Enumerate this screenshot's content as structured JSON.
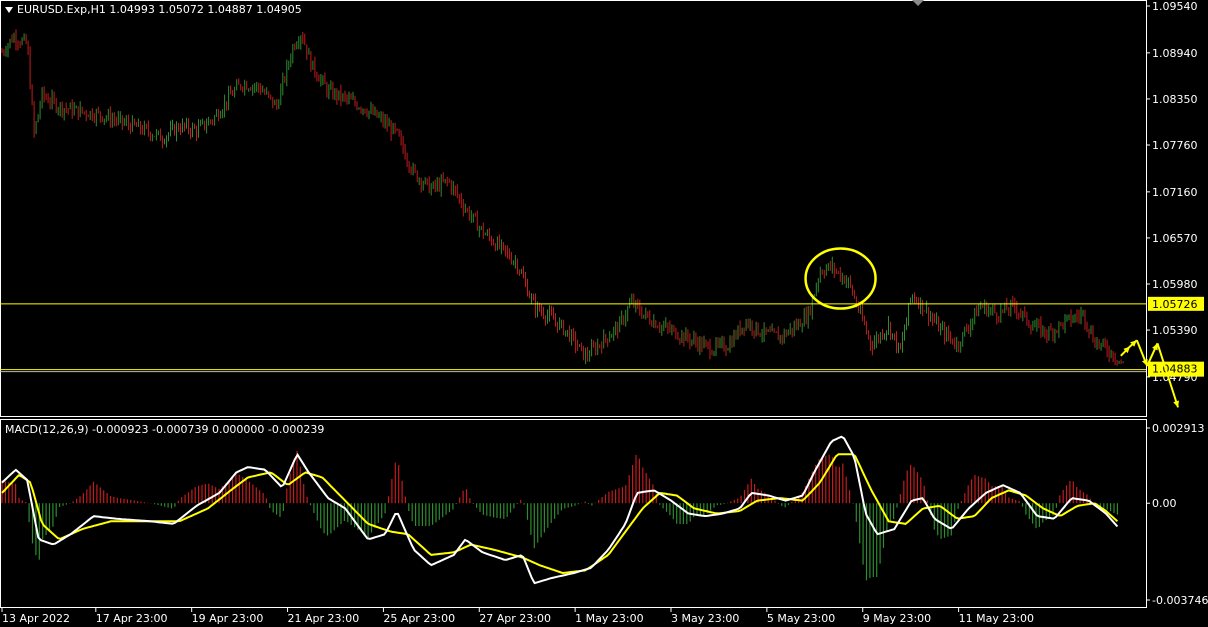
{
  "header": {
    "symbol_info": "EURUSD.Exp,H1  1.04993 1.05072 1.04887 1.04905"
  },
  "macd_header": "MACD(12,26,9) -0.000923 -0.000739 0.000000 -0.000239",
  "colors": {
    "background": "#000000",
    "bull": "#2e8b2e",
    "bear": "#c21c1c",
    "support_resistance": "#ffff00",
    "macd_line": "#ffffff",
    "signal_line": "#ffff00",
    "grid_text": "#ffffff"
  },
  "chart_data": [
    {
      "type": "candlestick",
      "title": "EURUSD.Exp,H1",
      "y_ticks": [
        "1.09540",
        "1.08940",
        "1.08350",
        "1.07760",
        "1.07160",
        "1.06570",
        "1.05980",
        "1.05390",
        "1.04790"
      ],
      "ylim": [
        1.0452,
        1.0954
      ],
      "x_ticks": [
        "13 Apr 2022",
        "17 Apr 23:00",
        "19 Apr 23:00",
        "21 Apr 23:00",
        "25 Apr 23:00",
        "27 Apr 23:00",
        "1 May 23:00",
        "3 May 23:00",
        "5 May 23:00",
        "9 May 23:00",
        "11 May 23:00"
      ],
      "price_path": [
        [
          0,
          1.0895
        ],
        [
          0.01,
          1.0915
        ],
        [
          0.022,
          1.0905
        ],
        [
          0.028,
          1.079
        ],
        [
          0.035,
          1.084
        ],
        [
          0.05,
          1.0825
        ],
        [
          0.065,
          1.082
        ],
        [
          0.085,
          1.0815
        ],
        [
          0.105,
          1.0805
        ],
        [
          0.125,
          1.0795
        ],
        [
          0.14,
          1.0785
        ],
        [
          0.155,
          1.08
        ],
        [
          0.17,
          1.0795
        ],
        [
          0.185,
          1.081
        ],
        [
          0.2,
          1.084
        ],
        [
          0.21,
          1.0855
        ],
        [
          0.225,
          1.085
        ],
        [
          0.24,
          1.0825
        ],
        [
          0.255,
          1.0905
        ],
        [
          0.262,
          1.092
        ],
        [
          0.27,
          1.088
        ],
        [
          0.285,
          1.0845
        ],
        [
          0.3,
          1.0835
        ],
        [
          0.315,
          1.0825
        ],
        [
          0.33,
          1.081
        ],
        [
          0.345,
          1.079
        ],
        [
          0.36,
          1.074
        ],
        [
          0.375,
          1.072
        ],
        [
          0.39,
          1.073
        ],
        [
          0.405,
          1.0695
        ],
        [
          0.42,
          1.0665
        ],
        [
          0.435,
          1.0645
        ],
        [
          0.45,
          1.0625
        ],
        [
          0.465,
          1.057
        ],
        [
          0.48,
          1.0555
        ],
        [
          0.495,
          1.0535
        ],
        [
          0.51,
          1.0505
        ],
        [
          0.525,
          1.0525
        ],
        [
          0.54,
          1.0545
        ],
        [
          0.55,
          1.0575
        ],
        [
          0.56,
          1.056
        ],
        [
          0.575,
          1.0545
        ],
        [
          0.59,
          1.0535
        ],
        [
          0.605,
          1.0525
        ],
        [
          0.62,
          1.0515
        ],
        [
          0.635,
          1.052
        ],
        [
          0.65,
          1.055
        ],
        [
          0.665,
          1.0535
        ],
        [
          0.68,
          1.053
        ],
        [
          0.695,
          1.0545
        ],
        [
          0.705,
          1.056
        ],
        [
          0.715,
          1.0615
        ],
        [
          0.725,
          1.062
        ],
        [
          0.74,
          1.06
        ],
        [
          0.75,
          1.056
        ],
        [
          0.76,
          1.052
        ],
        [
          0.775,
          1.0545
        ],
        [
          0.785,
          1.051
        ],
        [
          0.795,
          1.0585
        ],
        [
          0.805,
          1.057
        ],
        [
          0.82,
          1.054
        ],
        [
          0.835,
          1.052
        ],
        [
          0.845,
          1.0545
        ],
        [
          0.855,
          1.057
        ],
        [
          0.87,
          1.056
        ],
        [
          0.885,
          1.057
        ],
        [
          0.9,
          1.0545
        ],
        [
          0.915,
          1.0535
        ],
        [
          0.93,
          1.055
        ],
        [
          0.945,
          1.056
        ],
        [
          0.955,
          1.0525
        ],
        [
          0.97,
          1.051
        ],
        [
          0.98,
          1.0495
        ]
      ],
      "support_level": 1.04883,
      "support_label": "1.04883",
      "resistance_level": 1.05726,
      "resistance_label": "1.05726",
      "annotations": [
        {
          "kind": "circle",
          "x_frac": 0.733,
          "y_value": 1.0605
        },
        {
          "kind": "projection_arrows",
          "points": [
            [
              0.978,
              1.0506
            ],
            [
              0.986,
              1.0518
            ],
            [
              0.992,
              1.0526
            ],
            [
              1.001,
              1.0493
            ],
            [
              1.01,
              1.0522
            ],
            [
              1.028,
              1.044
            ]
          ]
        }
      ]
    },
    {
      "type": "macd",
      "title": "MACD(12,26,9)",
      "values_text": "-0.000923 -0.000739 0.000000 -0.000239",
      "y_ticks": [
        "0.002913",
        "0.00",
        "-0.003746"
      ],
      "ylim": [
        -0.003746,
        0.002913
      ],
      "macd_path": [
        [
          0,
          0.0008
        ],
        [
          0.012,
          0.0013
        ],
        [
          0.022,
          0.0009
        ],
        [
          0.032,
          -0.0014
        ],
        [
          0.045,
          -0.0016
        ],
        [
          0.06,
          -0.0012
        ],
        [
          0.08,
          -0.0005
        ],
        [
          0.1,
          -0.0006
        ],
        [
          0.13,
          -0.0007
        ],
        [
          0.15,
          -0.0008
        ],
        [
          0.17,
          -0.0001
        ],
        [
          0.19,
          0.0004
        ],
        [
          0.205,
          0.0012
        ],
        [
          0.215,
          0.0014
        ],
        [
          0.23,
          0.0013
        ],
        [
          0.245,
          0.0006
        ],
        [
          0.258,
          0.0019
        ],
        [
          0.268,
          0.0012
        ],
        [
          0.285,
          0.0002
        ],
        [
          0.3,
          -0.0002
        ],
        [
          0.32,
          -0.0014
        ],
        [
          0.335,
          -0.0012
        ],
        [
          0.345,
          -0.0003
        ],
        [
          0.36,
          -0.0018
        ],
        [
          0.375,
          -0.0024
        ],
        [
          0.395,
          -0.002
        ],
        [
          0.405,
          -0.0014
        ],
        [
          0.42,
          -0.0019
        ],
        [
          0.44,
          -0.0022
        ],
        [
          0.455,
          -0.002
        ],
        [
          0.465,
          -0.0031
        ],
        [
          0.48,
          -0.0029
        ],
        [
          0.5,
          -0.0027
        ],
        [
          0.515,
          -0.0025
        ],
        [
          0.53,
          -0.0018
        ],
        [
          0.545,
          -0.0008
        ],
        [
          0.555,
          0.0004
        ],
        [
          0.57,
          0.0005
        ],
        [
          0.585,
          0.0001
        ],
        [
          0.6,
          -0.0004
        ],
        [
          0.615,
          -0.0005
        ],
        [
          0.63,
          -0.0004
        ],
        [
          0.645,
          -0.0002
        ],
        [
          0.655,
          0.0004
        ],
        [
          0.67,
          0.0003
        ],
        [
          0.685,
          0.0001
        ],
        [
          0.7,
          0.0003
        ],
        [
          0.71,
          0.0012
        ],
        [
          0.725,
          0.0024
        ],
        [
          0.735,
          0.0026
        ],
        [
          0.745,
          0.0018
        ],
        [
          0.755,
          -0.0004
        ],
        [
          0.765,
          -0.0012
        ],
        [
          0.78,
          -0.001
        ],
        [
          0.795,
          0.0001
        ],
        [
          0.805,
          0.0002
        ],
        [
          0.815,
          -0.0006
        ],
        [
          0.83,
          -0.001
        ],
        [
          0.845,
          -0.0002
        ],
        [
          0.86,
          0.0004
        ],
        [
          0.875,
          0.0007
        ],
        [
          0.89,
          0.0004
        ],
        [
          0.905,
          -0.0005
        ],
        [
          0.92,
          -0.0006
        ],
        [
          0.935,
          0.0002
        ],
        [
          0.95,
          0.0001
        ],
        [
          0.965,
          -0.0004
        ],
        [
          0.975,
          -0.0009
        ]
      ],
      "signal_path": [
        [
          0,
          0.0004
        ],
        [
          0.015,
          0.0011
        ],
        [
          0.025,
          0.0008
        ],
        [
          0.035,
          -0.0008
        ],
        [
          0.05,
          -0.0014
        ],
        [
          0.07,
          -0.001
        ],
        [
          0.095,
          -0.0007
        ],
        [
          0.13,
          -0.0007
        ],
        [
          0.155,
          -0.0007
        ],
        [
          0.18,
          -0.0002
        ],
        [
          0.2,
          0.0005
        ],
        [
          0.215,
          0.001
        ],
        [
          0.235,
          0.0012
        ],
        [
          0.25,
          0.0007
        ],
        [
          0.265,
          0.0012
        ],
        [
          0.28,
          0.001
        ],
        [
          0.3,
          0.0001
        ],
        [
          0.32,
          -0.0008
        ],
        [
          0.34,
          -0.0011
        ],
        [
          0.355,
          -0.0012
        ],
        [
          0.375,
          -0.002
        ],
        [
          0.395,
          -0.0019
        ],
        [
          0.41,
          -0.0016
        ],
        [
          0.43,
          -0.0018
        ],
        [
          0.455,
          -0.0021
        ],
        [
          0.47,
          -0.0024
        ],
        [
          0.49,
          -0.0027
        ],
        [
          0.51,
          -0.0026
        ],
        [
          0.53,
          -0.002
        ],
        [
          0.545,
          -0.0011
        ],
        [
          0.56,
          -0.0002
        ],
        [
          0.575,
          0.0004
        ],
        [
          0.59,
          0.0003
        ],
        [
          0.605,
          -0.0002
        ],
        [
          0.625,
          -0.0004
        ],
        [
          0.645,
          -0.0003
        ],
        [
          0.66,
          0.0001
        ],
        [
          0.68,
          0.0002
        ],
        [
          0.7,
          0.0001
        ],
        [
          0.715,
          0.0008
        ],
        [
          0.73,
          0.0019
        ],
        [
          0.745,
          0.0019
        ],
        [
          0.76,
          0.0005
        ],
        [
          0.775,
          -0.0007
        ],
        [
          0.79,
          -0.0008
        ],
        [
          0.805,
          -0.0002
        ],
        [
          0.82,
          -0.0001
        ],
        [
          0.835,
          -0.0006
        ],
        [
          0.85,
          -0.0005
        ],
        [
          0.865,
          0.0002
        ],
        [
          0.88,
          0.0005
        ],
        [
          0.895,
          0.0003
        ],
        [
          0.91,
          -0.0002
        ],
        [
          0.925,
          -0.0005
        ],
        [
          0.94,
          -0.0001
        ],
        [
          0.955,
          0.0
        ],
        [
          0.965,
          -0.0003
        ],
        [
          0.975,
          -0.0007
        ]
      ]
    }
  ]
}
